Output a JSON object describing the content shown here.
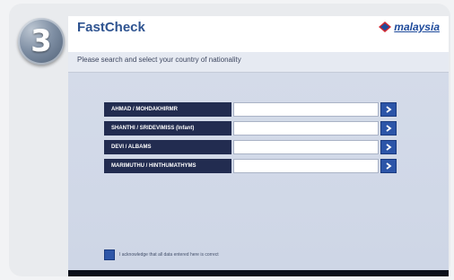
{
  "step": {
    "number": "3"
  },
  "header": {
    "title": "FastCheck",
    "brand": "malaysia",
    "brand_color": "#1e4a9b",
    "brand_icon": "kite-logo-icon"
  },
  "prompt": "Please search and select your country of nationality",
  "passengers": [
    {
      "name": "AHMAD / MOHDAKHIRMR",
      "field_value": ""
    },
    {
      "name": "SHANTHI / SRIDEVIMISS  (Infant)",
      "field_value": ""
    },
    {
      "name": "DEVI / ALBAMS",
      "field_value": ""
    },
    {
      "name": "MARIMUTHU / HINTHUMATHYMS",
      "field_value": ""
    }
  ],
  "select_icon": "chevron-right-icon",
  "acknowledge": "I acknowledge that all data entered here is correct",
  "colors": {
    "accent": "#2c55a8",
    "name_cell": "#222c50",
    "background": "#d2d9e8"
  }
}
